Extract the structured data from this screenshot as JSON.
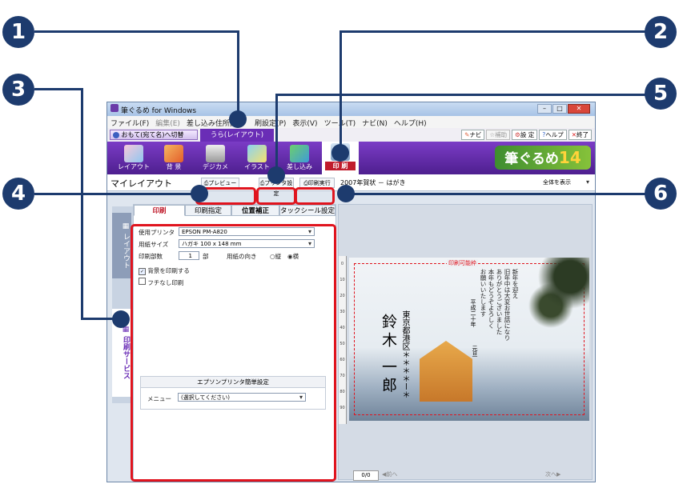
{
  "callouts": [
    "1",
    "2",
    "3",
    "4",
    "5",
    "6"
  ],
  "window": {
    "title": "筆ぐるめ for Windows",
    "menu": [
      "ファイル(F)",
      "編集(E)",
      "差し込み住所録",
      "刷設定(P)",
      "表示(V)",
      "ツール(T)",
      "ナビ(N)",
      "ヘルプ(H)"
    ],
    "switch_front": "おもて(宛て名)へ切替",
    "back_tab": "うら(レイアウト)",
    "tools": [
      "ナビ",
      "補助",
      "設 定",
      "ヘルプ",
      "終了"
    ],
    "ribbon": [
      "レイアウト",
      "背 景",
      "デジカメ",
      "イラスト",
      "差し込み",
      "印 刷"
    ],
    "brand": "筆ぐるめ",
    "brand_num": "14",
    "my_layout": "マイレイアウト",
    "preview_btn": "プレビュー",
    "printer_btn": "プリンタ設定",
    "print_btn": "印刷実行",
    "doc_name": "2007年賀状 － はがき",
    "view_mode": "全体を表示"
  },
  "side_tabs": [
    "レイアウト",
    "印刷サービス"
  ],
  "panel": {
    "tabs": [
      "印刷",
      "印刷指定",
      "位置補正",
      "タックシール設定"
    ],
    "printer_label": "使用プリンタ",
    "printer_value": "EPSON PM-A820",
    "paper_label": "用紙サイズ",
    "paper_value": "ハガキ 100 x 148 mm",
    "copies_label": "印刷部数",
    "copies_value": "1",
    "copies_unit": "部",
    "orient_label": "用紙の向き",
    "orient_tate": "縦",
    "orient_yoko": "横",
    "bg_print": "背景を印刷する",
    "borderless": "フチなし印刷",
    "epson_title": "エプソンプリンタ簡単設定",
    "menu_label": "メニュー",
    "menu_value": "(選択してください)"
  },
  "card": {
    "printable": "印刷可能枠",
    "greeting": [
      "新年を迎え",
      "旧年中は大変お世話になり",
      "ありがとうございました",
      "本年もどうぞよろしく",
      "お願いいたします"
    ],
    "date": "平成二十年",
    "newyear": "元旦",
    "address": "東京都港区＊＊＊＊ー＊",
    "name": "鈴木 一郎",
    "ruler": [
      "0",
      "10",
      "20",
      "30",
      "40",
      "50",
      "60",
      "70",
      "80",
      "90"
    ]
  },
  "pager": {
    "page": "0/0",
    "prev": "前へ",
    "next": "次へ"
  }
}
